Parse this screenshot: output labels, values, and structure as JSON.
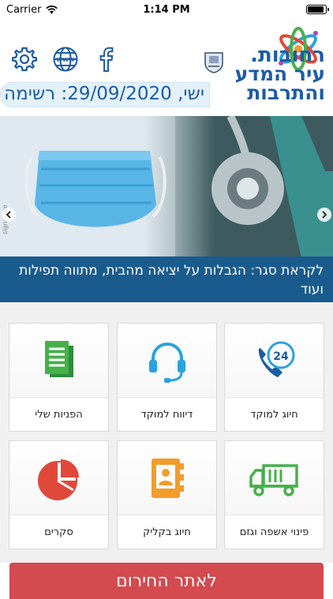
{
  "status": {
    "carrier": "Carrier",
    "time": "1:14 PM"
  },
  "header": {
    "logo": {
      "line1": "רחובות.",
      "line2": "עיר המדע",
      "line3": "והתרבות"
    },
    "icons": [
      "settings-icon",
      "globe-icon",
      "facebook-icon"
    ]
  },
  "ticker": {
    "text": "ישי, 29/09/2020: רשימה ש"
  },
  "banner": {
    "caption": "לקראת סגר: הגבלות על יציאה מהבית, מתווה תפילות ועוד",
    "watermark": "signature"
  },
  "tiles": [
    {
      "label": "חיוג למוקד",
      "icon": "phone-24-icon"
    },
    {
      "label": "דיווח למוקד",
      "icon": "headset-icon"
    },
    {
      "label": "הפניות שלי",
      "icon": "documents-icon"
    },
    {
      "label": "פינוי אשפה וגזם",
      "icon": "garbage-truck-icon"
    },
    {
      "label": "חיוג בקליק",
      "icon": "contacts-book-icon"
    },
    {
      "label": "סקרים",
      "icon": "pie-chart-icon"
    }
  ],
  "emergency": {
    "label": "לאתר החירום"
  },
  "colors": {
    "brand_blue": "#1d5ba7",
    "accent_blue": "#2aa2dc",
    "green": "#46b04a",
    "red": "#e0483a",
    "orange": "#f29c2b",
    "emergency_red": "#d34a4f"
  }
}
